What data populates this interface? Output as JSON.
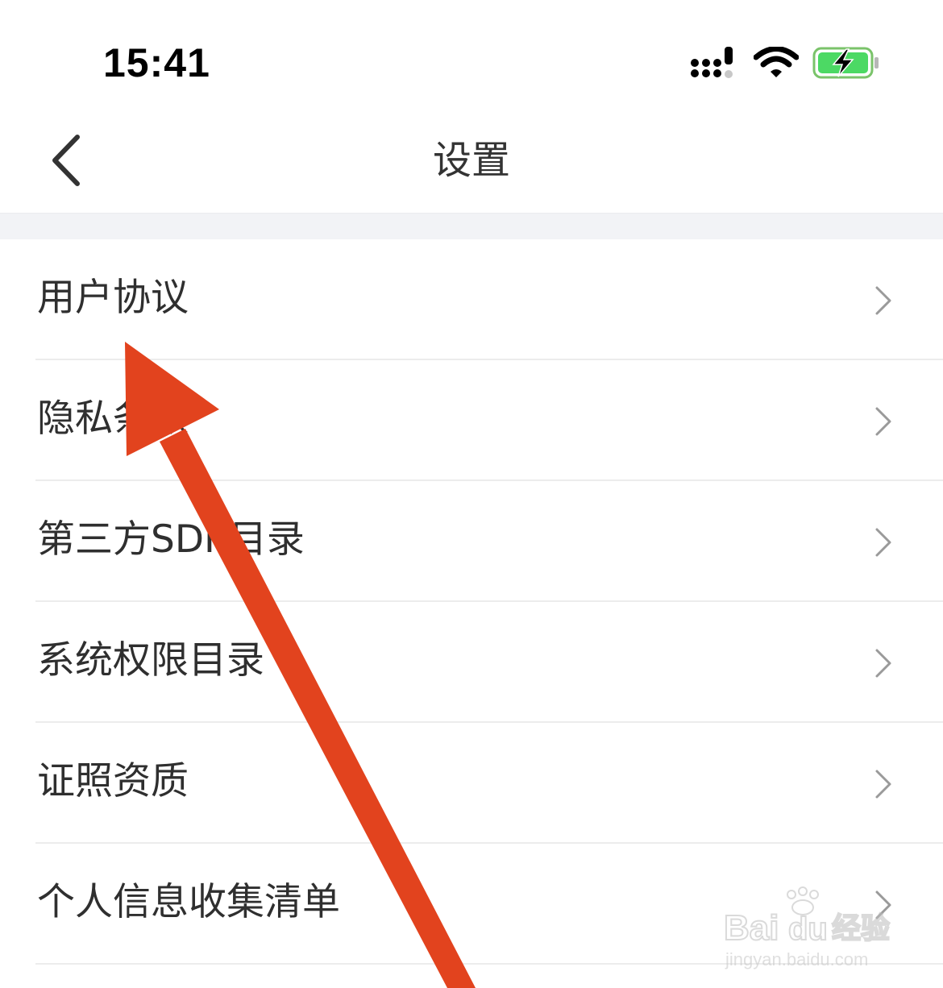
{
  "status_bar": {
    "time": "15:41",
    "icons": [
      "cellular-signal-icon",
      "wifi-icon",
      "battery-charging-icon"
    ],
    "battery_color": "#4cd964"
  },
  "nav": {
    "back_icon": "chevron-left-icon",
    "title": "设置"
  },
  "settings": {
    "items": [
      {
        "label": "用户协议"
      },
      {
        "label": "隐私条款"
      },
      {
        "label": "第三方SDK目录"
      },
      {
        "label": "系统权限目录"
      },
      {
        "label": "证照资质"
      },
      {
        "label": "个人信息收集清单"
      }
    ],
    "chevron_icon": "chevron-right-icon"
  },
  "annotation": {
    "arrow_color": "#e2431e",
    "points_to": "用户协议"
  },
  "watermark": {
    "logo_text": "Bai du 经验",
    "url": "jingyan.baidu.com"
  }
}
